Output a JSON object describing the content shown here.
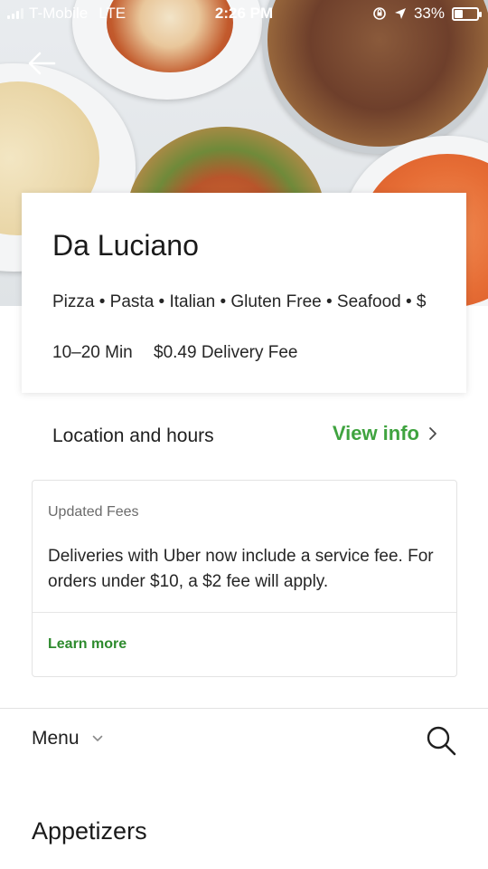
{
  "status_bar": {
    "carrier": "T-Mobile",
    "network": "LTE",
    "time": "2:26 PM",
    "battery": "33%",
    "battery_level": 0.33
  },
  "header": {
    "back_icon": "arrow-left-icon",
    "hero_image": "restaurant-dishes-photo"
  },
  "restaurant": {
    "name": "Da Luciano",
    "categories": "Pizza • Pasta • Italian • Gluten Free • Seafood • $",
    "delivery_time": "10–20 Min",
    "delivery_fee": "$0.49 Delivery Fee"
  },
  "location": {
    "label": "Location and hours",
    "action": "View info",
    "action_icon": "chevron-right-icon",
    "accent_color": "#3fa33f"
  },
  "fees_notice": {
    "title": "Updated Fees",
    "body": "Deliveries with Uber now include a service fee. For orders under $10, a $2 fee will apply.",
    "link": "Learn more"
  },
  "menu_bar": {
    "label": "Menu",
    "dropdown_icon": "chevron-down-icon",
    "search_icon": "search-icon"
  },
  "section": {
    "title": "Appetizers"
  }
}
